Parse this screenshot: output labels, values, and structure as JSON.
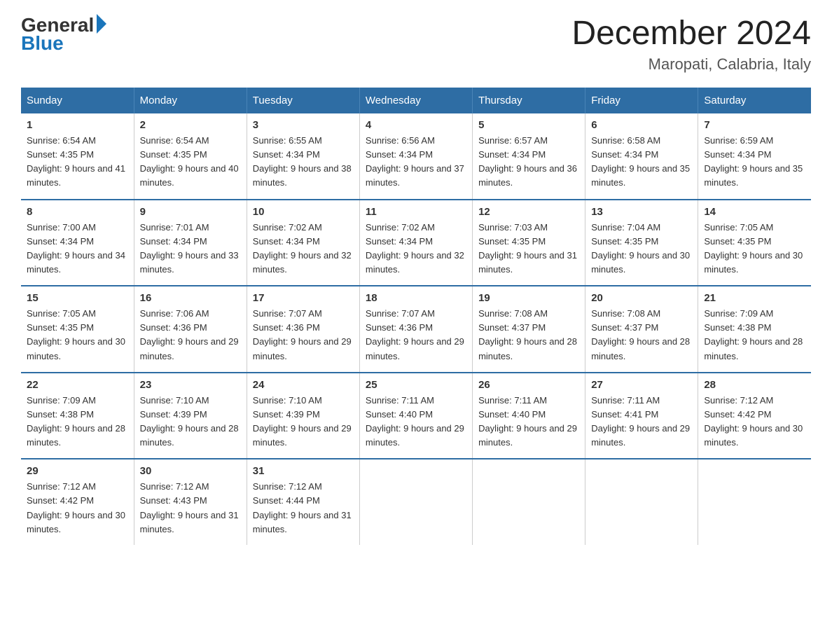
{
  "header": {
    "logo_general": "General",
    "logo_blue": "Blue",
    "month_year": "December 2024",
    "location": "Maropati, Calabria, Italy"
  },
  "days_of_week": [
    "Sunday",
    "Monday",
    "Tuesday",
    "Wednesday",
    "Thursday",
    "Friday",
    "Saturday"
  ],
  "weeks": [
    [
      {
        "day": "1",
        "sunrise": "6:54 AM",
        "sunset": "4:35 PM",
        "daylight": "9 hours and 41 minutes."
      },
      {
        "day": "2",
        "sunrise": "6:54 AM",
        "sunset": "4:35 PM",
        "daylight": "9 hours and 40 minutes."
      },
      {
        "day": "3",
        "sunrise": "6:55 AM",
        "sunset": "4:34 PM",
        "daylight": "9 hours and 38 minutes."
      },
      {
        "day": "4",
        "sunrise": "6:56 AM",
        "sunset": "4:34 PM",
        "daylight": "9 hours and 37 minutes."
      },
      {
        "day": "5",
        "sunrise": "6:57 AM",
        "sunset": "4:34 PM",
        "daylight": "9 hours and 36 minutes."
      },
      {
        "day": "6",
        "sunrise": "6:58 AM",
        "sunset": "4:34 PM",
        "daylight": "9 hours and 35 minutes."
      },
      {
        "day": "7",
        "sunrise": "6:59 AM",
        "sunset": "4:34 PM",
        "daylight": "9 hours and 35 minutes."
      }
    ],
    [
      {
        "day": "8",
        "sunrise": "7:00 AM",
        "sunset": "4:34 PM",
        "daylight": "9 hours and 34 minutes."
      },
      {
        "day": "9",
        "sunrise": "7:01 AM",
        "sunset": "4:34 PM",
        "daylight": "9 hours and 33 minutes."
      },
      {
        "day": "10",
        "sunrise": "7:02 AM",
        "sunset": "4:34 PM",
        "daylight": "9 hours and 32 minutes."
      },
      {
        "day": "11",
        "sunrise": "7:02 AM",
        "sunset": "4:34 PM",
        "daylight": "9 hours and 32 minutes."
      },
      {
        "day": "12",
        "sunrise": "7:03 AM",
        "sunset": "4:35 PM",
        "daylight": "9 hours and 31 minutes."
      },
      {
        "day": "13",
        "sunrise": "7:04 AM",
        "sunset": "4:35 PM",
        "daylight": "9 hours and 30 minutes."
      },
      {
        "day": "14",
        "sunrise": "7:05 AM",
        "sunset": "4:35 PM",
        "daylight": "9 hours and 30 minutes."
      }
    ],
    [
      {
        "day": "15",
        "sunrise": "7:05 AM",
        "sunset": "4:35 PM",
        "daylight": "9 hours and 30 minutes."
      },
      {
        "day": "16",
        "sunrise": "7:06 AM",
        "sunset": "4:36 PM",
        "daylight": "9 hours and 29 minutes."
      },
      {
        "day": "17",
        "sunrise": "7:07 AM",
        "sunset": "4:36 PM",
        "daylight": "9 hours and 29 minutes."
      },
      {
        "day": "18",
        "sunrise": "7:07 AM",
        "sunset": "4:36 PM",
        "daylight": "9 hours and 29 minutes."
      },
      {
        "day": "19",
        "sunrise": "7:08 AM",
        "sunset": "4:37 PM",
        "daylight": "9 hours and 28 minutes."
      },
      {
        "day": "20",
        "sunrise": "7:08 AM",
        "sunset": "4:37 PM",
        "daylight": "9 hours and 28 minutes."
      },
      {
        "day": "21",
        "sunrise": "7:09 AM",
        "sunset": "4:38 PM",
        "daylight": "9 hours and 28 minutes."
      }
    ],
    [
      {
        "day": "22",
        "sunrise": "7:09 AM",
        "sunset": "4:38 PM",
        "daylight": "9 hours and 28 minutes."
      },
      {
        "day": "23",
        "sunrise": "7:10 AM",
        "sunset": "4:39 PM",
        "daylight": "9 hours and 28 minutes."
      },
      {
        "day": "24",
        "sunrise": "7:10 AM",
        "sunset": "4:39 PM",
        "daylight": "9 hours and 29 minutes."
      },
      {
        "day": "25",
        "sunrise": "7:11 AM",
        "sunset": "4:40 PM",
        "daylight": "9 hours and 29 minutes."
      },
      {
        "day": "26",
        "sunrise": "7:11 AM",
        "sunset": "4:40 PM",
        "daylight": "9 hours and 29 minutes."
      },
      {
        "day": "27",
        "sunrise": "7:11 AM",
        "sunset": "4:41 PM",
        "daylight": "9 hours and 29 minutes."
      },
      {
        "day": "28",
        "sunrise": "7:12 AM",
        "sunset": "4:42 PM",
        "daylight": "9 hours and 30 minutes."
      }
    ],
    [
      {
        "day": "29",
        "sunrise": "7:12 AM",
        "sunset": "4:42 PM",
        "daylight": "9 hours and 30 minutes."
      },
      {
        "day": "30",
        "sunrise": "7:12 AM",
        "sunset": "4:43 PM",
        "daylight": "9 hours and 31 minutes."
      },
      {
        "day": "31",
        "sunrise": "7:12 AM",
        "sunset": "4:44 PM",
        "daylight": "9 hours and 31 minutes."
      },
      null,
      null,
      null,
      null
    ]
  ]
}
